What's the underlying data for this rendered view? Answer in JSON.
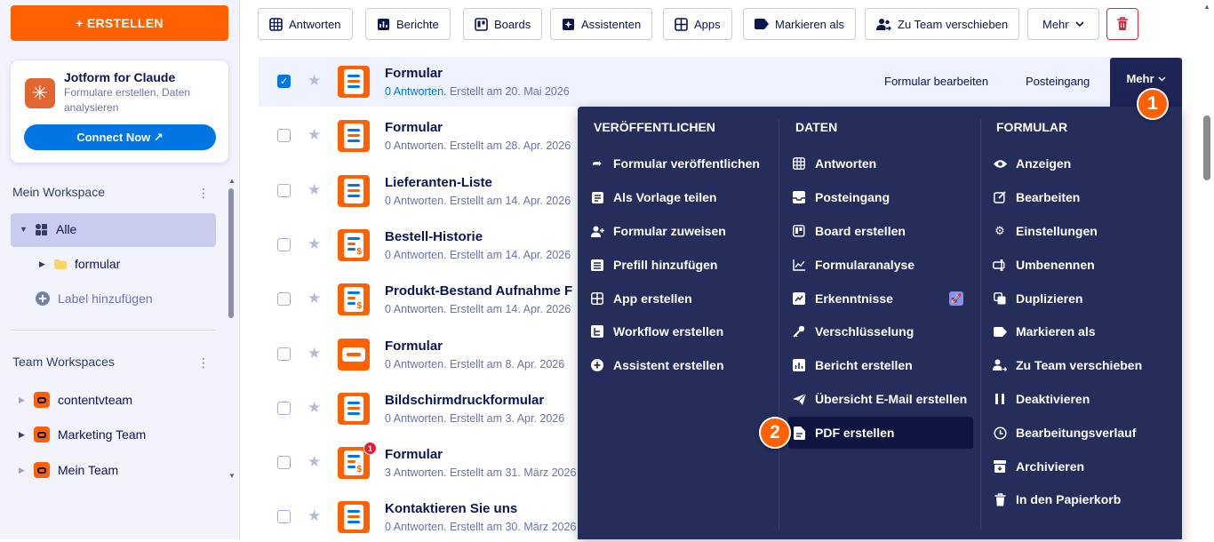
{
  "sidebar": {
    "create_label": "+ ERSTELLEN",
    "promo": {
      "title": "Jotform for Claude",
      "subtitle": "Formulare erstellen, Daten analysieren",
      "connect_label": "Connect Now ↗"
    },
    "my_workspace_label": "Mein Workspace",
    "nav_all_label": "Alle",
    "folder_label": "formular",
    "add_label": "Label hinzufügen",
    "team_workspaces_label": "Team Workspaces",
    "teams": [
      {
        "label": "contentvteam"
      },
      {
        "label": "Marketing Team"
      },
      {
        "label": "Mein Team"
      }
    ]
  },
  "toolbar": {
    "buttons": [
      "Antworten",
      "Berichte",
      "Boards",
      "Assistenten",
      "Apps",
      "Markieren als",
      "Zu Team verschieben",
      "Mehr"
    ]
  },
  "forms": [
    {
      "title": "Formular",
      "responses": "0 Antworten.",
      "created": "Erstellt am 20. Mai 2026",
      "selected": true,
      "icon": "form-icon"
    },
    {
      "title": "Formular",
      "responses": "0 Antworten.",
      "created": "Erstellt am 28. Apr. 2026",
      "icon": "form-icon"
    },
    {
      "title": "Lieferanten-Liste",
      "responses": "0 Antworten.",
      "created": "Erstellt am 14. Apr. 2026",
      "icon": "form-icon"
    },
    {
      "title": "Bestell-Historie",
      "responses": "0 Antworten.",
      "created": "Erstellt am 14. Apr. 2026",
      "icon": "payment-form-icon"
    },
    {
      "title": "Produkt-Bestand Aufnahme F",
      "responses": "0 Antworten.",
      "created": "Erstellt am 14. Apr. 2026",
      "icon": "payment-form-icon"
    },
    {
      "title": "Formular",
      "responses": "0 Antworten.",
      "created": "Erstellt am 8. Apr. 2026",
      "icon": "card-form-icon"
    },
    {
      "title": "Bildschirmdruckformular",
      "responses": "0 Antworten.",
      "created": "Erstellt am 3. Apr. 2026",
      "icon": "form-icon"
    },
    {
      "title": "Formular",
      "responses": "3 Antworten.",
      "created": "Erstellt am 31. März 2026",
      "icon": "payment-form-icon",
      "badge": "1"
    },
    {
      "title": "Kontaktieren Sie uns",
      "responses": "0 Antworten.",
      "created": "Erstellt am 30. März 2026",
      "icon": "form-icon"
    }
  ],
  "row_actions": {
    "edit": "Formular bearbeiten",
    "inbox": "Posteingang",
    "more": "Mehr"
  },
  "dropdown": {
    "columns": [
      {
        "heading": "VERÖFFENTLICHEN",
        "items": [
          "Formular veröffentlichen",
          "Als Vorlage teilen",
          "Formular zuweisen",
          "Prefill hinzufügen",
          "App erstellen",
          "Workflow erstellen",
          "Assistent erstellen"
        ]
      },
      {
        "heading": "DATEN",
        "items": [
          "Antworten",
          "Posteingang",
          "Board erstellen",
          "Formularanalyse",
          "Erkenntnisse",
          "Verschlüsselung",
          "Bericht erstellen",
          "Übersicht E-Mail erstellen",
          "PDF erstellen"
        ]
      },
      {
        "heading": "FORMULAR",
        "items": [
          "Anzeigen",
          "Bearbeiten",
          "Einstellungen",
          "Umbenennen",
          "Duplizieren",
          "Markieren als",
          "Zu Team verschieben",
          "Deaktivieren",
          "Bearbeitungsverlauf",
          "Archivieren",
          "In den Papierkorb"
        ]
      }
    ]
  },
  "callouts": [
    "1",
    "2"
  ],
  "colors": {
    "accent": "#ff6100",
    "primary_blue": "#0075e3",
    "menu_bg": "#252d5b",
    "danger": "#d6263a"
  }
}
